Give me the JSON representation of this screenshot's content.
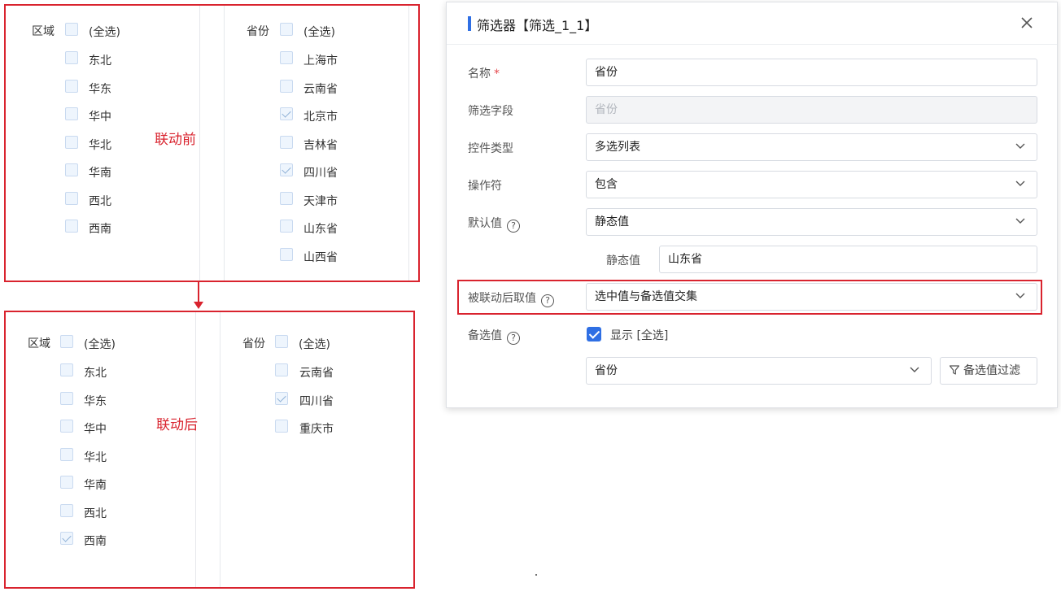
{
  "before": {
    "tag": "联动前",
    "region": {
      "label": "区域",
      "select_all": "(全选)",
      "options": [
        {
          "label": "东北",
          "checked": false
        },
        {
          "label": "华东",
          "checked": false
        },
        {
          "label": "华中",
          "checked": false
        },
        {
          "label": "华北",
          "checked": false
        },
        {
          "label": "华南",
          "checked": false
        },
        {
          "label": "西北",
          "checked": false
        },
        {
          "label": "西南",
          "checked": false
        }
      ]
    },
    "province": {
      "label": "省份",
      "select_all": "(全选)",
      "options": [
        {
          "label": "上海市",
          "checked": false
        },
        {
          "label": "云南省",
          "checked": false
        },
        {
          "label": "北京市",
          "checked": true
        },
        {
          "label": "吉林省",
          "checked": false
        },
        {
          "label": "四川省",
          "checked": true
        },
        {
          "label": "天津市",
          "checked": false
        },
        {
          "label": "山东省",
          "checked": false
        },
        {
          "label": "山西省",
          "checked": false
        }
      ]
    }
  },
  "after": {
    "tag": "联动后",
    "region": {
      "label": "区域",
      "select_all": "(全选)",
      "options": [
        {
          "label": "东北",
          "checked": false
        },
        {
          "label": "华东",
          "checked": false
        },
        {
          "label": "华中",
          "checked": false
        },
        {
          "label": "华北",
          "checked": false
        },
        {
          "label": "华南",
          "checked": false
        },
        {
          "label": "西北",
          "checked": false
        },
        {
          "label": "西南",
          "checked": true
        }
      ]
    },
    "province": {
      "label": "省份",
      "select_all": "(全选)",
      "options": [
        {
          "label": "云南省",
          "checked": false
        },
        {
          "label": "四川省",
          "checked": true
        },
        {
          "label": "重庆市",
          "checked": false
        }
      ]
    }
  },
  "dialog": {
    "title": "筛选器【筛选_1_1】",
    "name_label": "名称",
    "required_mark": "*",
    "name_value": "省份",
    "field_label": "筛选字段",
    "field_value": "省份",
    "control_type_label": "控件类型",
    "control_type_value": "多选列表",
    "operator_label": "操作符",
    "operator_value": "包含",
    "default_label": "默认值",
    "default_value": "静态值",
    "static_label": "静态值",
    "static_value": "山东省",
    "linked_label": "被联动后取值",
    "linked_value": "选中值与备选值交集",
    "candidate_label": "备选值",
    "show_all_label": "显示 [全选]",
    "show_all_checked": true,
    "candidate_value": "省份",
    "filter_button": "备选值过滤",
    "help_glyph": "?"
  },
  "colors": {
    "annotation_red": "#d9232e",
    "accent_blue": "#2f6fe4"
  }
}
